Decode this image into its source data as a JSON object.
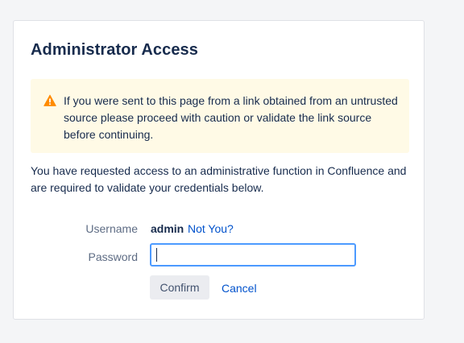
{
  "dialog": {
    "title": "Administrator Access",
    "warning": {
      "icon": "warning-icon",
      "text": "If you were sent to this page from a link obtained from an untrusted source please proceed with caution or validate the link source before continuing."
    },
    "intro": "You have requested access to an administrative function in Confluence and are required to validate your credentials below.",
    "form": {
      "username_label": "Username",
      "username_value": "admin",
      "not_you_link": "Not You?",
      "password_label": "Password",
      "password_value": "",
      "confirm_label": "Confirm",
      "cancel_label": "Cancel"
    }
  },
  "colors": {
    "warning_bg": "#fffae6",
    "warning_icon": "#ff8b00",
    "link": "#0052cc",
    "focus_border": "#4c9aff"
  }
}
